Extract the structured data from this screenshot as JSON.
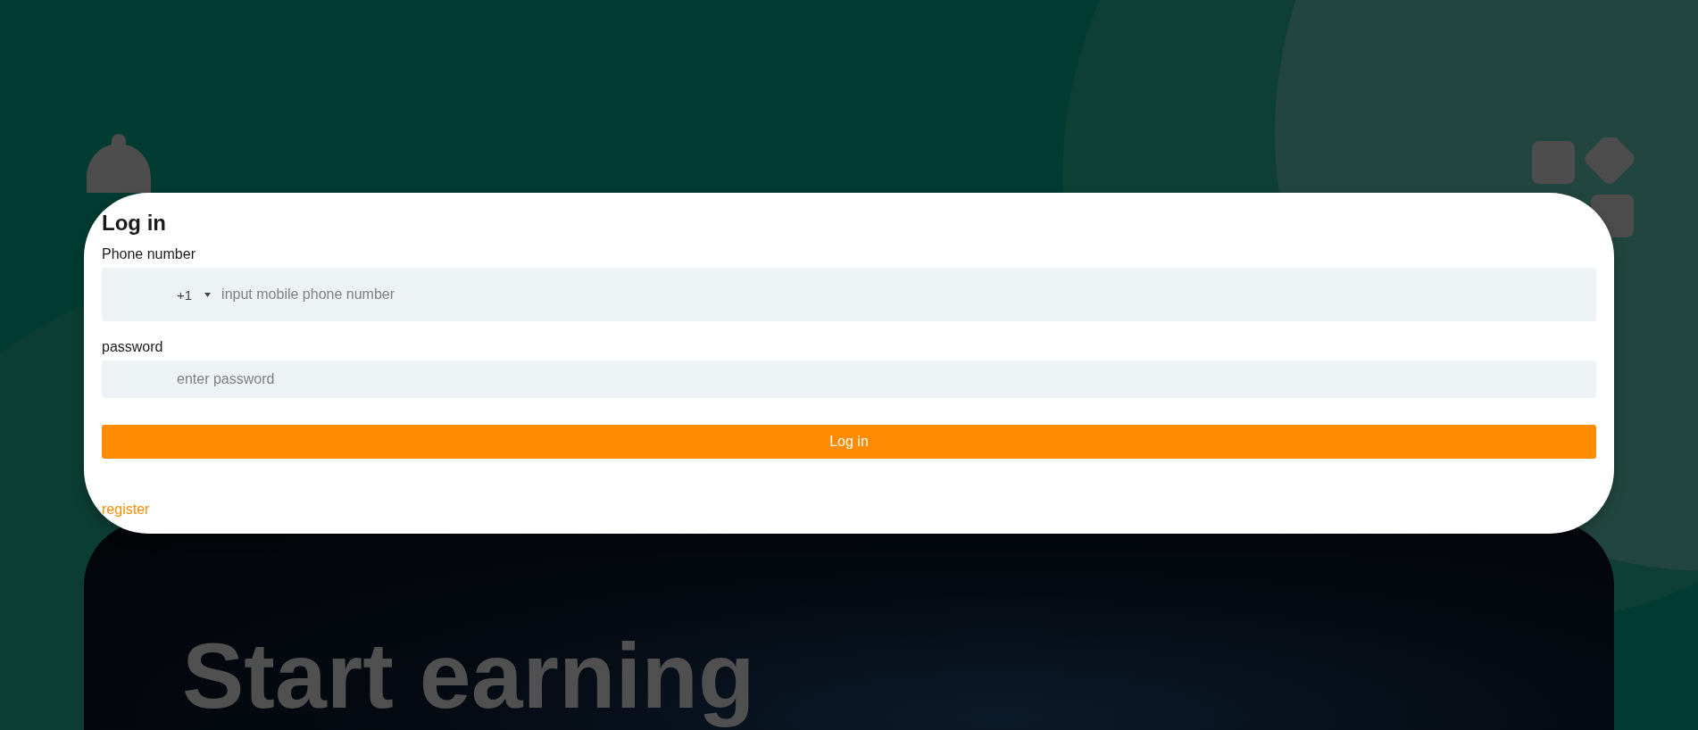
{
  "login_form": {
    "title": "Log in",
    "phone_label": "Phone number",
    "country_code": "+1",
    "phone_placeholder": "input mobile phone number",
    "password_label": "password",
    "password_placeholder": "enter password",
    "submit_button": "Log in",
    "register_link": "register"
  },
  "banner": {
    "heading": "Start earning"
  }
}
